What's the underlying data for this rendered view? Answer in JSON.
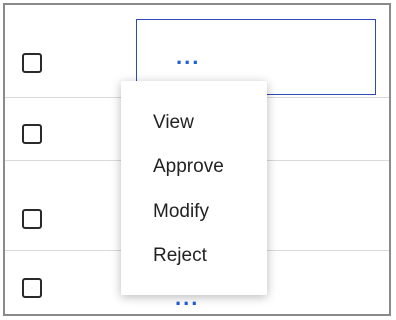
{
  "table": {
    "rows": [
      {
        "checkbox_checked": false,
        "actions_label": "..."
      },
      {
        "checkbox_checked": false,
        "actions_label": "..."
      },
      {
        "checkbox_checked": false,
        "actions_label": "..."
      },
      {
        "checkbox_checked": false,
        "actions_label": "..."
      }
    ]
  },
  "menu": {
    "items": [
      {
        "label": "View"
      },
      {
        "label": "Approve"
      },
      {
        "label": "Modify"
      },
      {
        "label": "Reject"
      }
    ]
  },
  "colors": {
    "accent": "#1f5fd6",
    "focus_border": "#2f4ab5",
    "divider": "#dadada"
  }
}
